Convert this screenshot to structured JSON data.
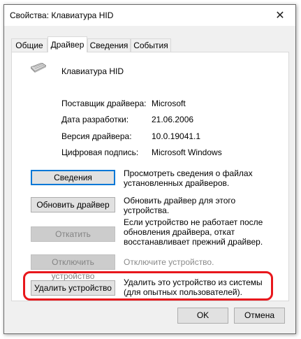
{
  "window": {
    "title": "Свойства: Клавиатура HID",
    "close_glyph": "✕"
  },
  "tabs": [
    {
      "label": "Общие"
    },
    {
      "label": "Драйвер"
    },
    {
      "label": "Сведения"
    },
    {
      "label": "События"
    }
  ],
  "device": {
    "icon": "keyboard-icon",
    "name": "Клавиатура HID"
  },
  "properties": [
    {
      "label": "Поставщик драйвера:",
      "value": "Microsoft"
    },
    {
      "label": "Дата разработки:",
      "value": "21.06.2006"
    },
    {
      "label": "Версия драйвера:",
      "value": "10.0.19041.1"
    },
    {
      "label": "Цифровая подпись:",
      "value": "Microsoft Windows"
    }
  ],
  "actions": [
    {
      "button": "Сведения",
      "description": "Просмотреть сведения о файлах установленных драйверов.",
      "enabled": true
    },
    {
      "button": "Обновить драйвер",
      "description": "Обновить драйвер для этого устройства.",
      "enabled": true
    },
    {
      "button": "Откатить",
      "description": "Если устройство не работает после обновления драйвера, откат восстанавливает прежний драйвер.",
      "enabled": false
    },
    {
      "button": "Отключить устройство",
      "description": "Отключите устройство.",
      "enabled": false
    },
    {
      "button": "Удалить устройство",
      "description": "Удалить это устройство из системы (для опытных пользователей).",
      "enabled": true
    }
  ],
  "footer": {
    "ok": "OK",
    "cancel": "Отмена"
  },
  "colors": {
    "highlight": "#e8171c",
    "focus": "#0078d7"
  }
}
